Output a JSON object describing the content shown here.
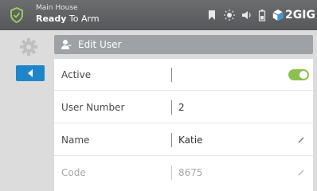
{
  "header": {
    "location": "Main House",
    "status_bold": "Ready",
    "status_rest": " To Arm",
    "brand": "2GIG",
    "icons": [
      "shield-icon",
      "bookmark-icon",
      "brightness-icon",
      "volume-icon",
      "battery-icon",
      "cube-logo-icon"
    ]
  },
  "page": {
    "title": "Edit User"
  },
  "sidebar": {
    "icons": [
      "gear-icon",
      "back-arrow-icon"
    ]
  },
  "rows": [
    {
      "label": "Active",
      "value": "",
      "toggle_on": true
    },
    {
      "label": "User Number",
      "value": "2"
    },
    {
      "label": "Name",
      "value": "Katie",
      "editable": true
    },
    {
      "label": "Code",
      "value": "8675",
      "editable": true
    }
  ],
  "colors": {
    "header": "#5f6164",
    "accent_blue": "#1e86c8",
    "toggle_green": "#8cc152",
    "titlebar": "#9ea2a6"
  }
}
